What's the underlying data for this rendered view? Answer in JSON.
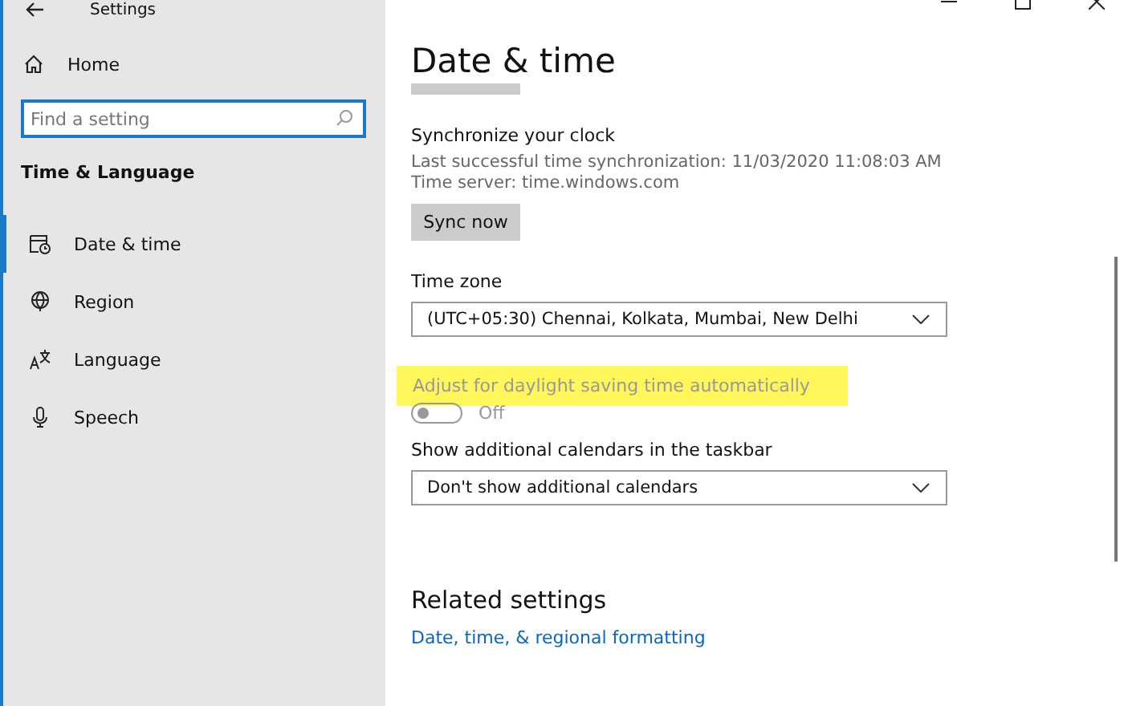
{
  "window": {
    "title": "Settings"
  },
  "sidebar": {
    "home": "Home",
    "search": {
      "placeholder": "Find a setting"
    },
    "section": "Time & Language",
    "items": [
      {
        "label": "Date & time",
        "selected": true
      },
      {
        "label": "Region",
        "selected": false
      },
      {
        "label": "Language",
        "selected": false
      },
      {
        "label": "Speech",
        "selected": false
      }
    ]
  },
  "content": {
    "title": "Date & time",
    "sync": {
      "heading": "Synchronize your clock",
      "last_sync": "Last successful time synchronization: 11/03/2020 11:08:03 AM",
      "server": "Time server: time.windows.com",
      "button": "Sync now"
    },
    "time_zone": {
      "label": "Time zone",
      "value": "(UTC+05:30) Chennai, Kolkata, Mumbai, New Delhi"
    },
    "daylight": {
      "label": "Adjust for daylight saving time automatically",
      "highlighted": true,
      "disabled": true,
      "on": false,
      "state_text": "Off"
    },
    "calendars": {
      "label": "Show additional calendars in the taskbar",
      "value": "Don't show additional calendars"
    },
    "related": {
      "heading": "Related settings",
      "link": "Date, time, & regional formatting"
    }
  }
}
